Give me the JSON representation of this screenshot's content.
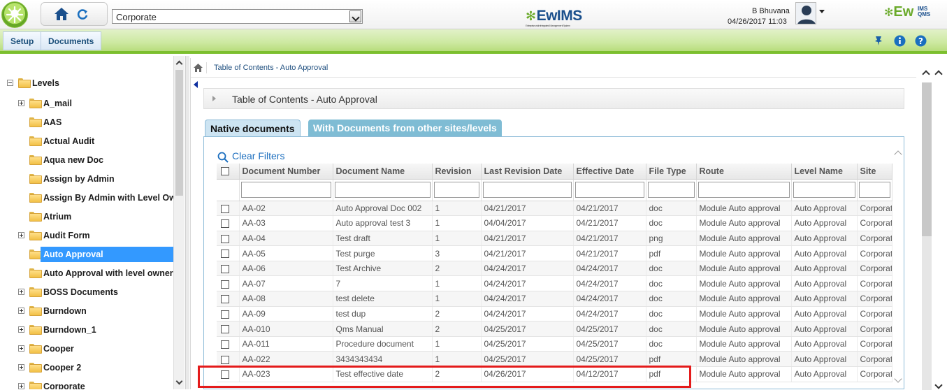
{
  "header": {
    "site_value": "Corporate",
    "brand_center": "EwIMS",
    "brand_center_sub": "Enterprise wide Integrated Management System",
    "user_name": "B Bhuvana",
    "datetime": "04/26/2017 11:03",
    "brand_right": "Ew",
    "brand_right_sup_1": "IMS",
    "brand_right_sup_2": "QMS"
  },
  "menu": {
    "setup": "Setup",
    "documents": "Documents"
  },
  "tree": {
    "root": "Levels",
    "items": [
      {
        "label": "A_mail",
        "expandable": true
      },
      {
        "label": "AAS",
        "expandable": false
      },
      {
        "label": "Actual Audit",
        "expandable": false
      },
      {
        "label": "Aqua new Doc",
        "expandable": false
      },
      {
        "label": "Assign by Admin",
        "expandable": false
      },
      {
        "label": "Assign By Admin with Level Owr",
        "expandable": false
      },
      {
        "label": "Atrium",
        "expandable": false
      },
      {
        "label": "Audit Form",
        "expandable": true
      },
      {
        "label": "Auto Approval",
        "expandable": false,
        "selected": true
      },
      {
        "label": "Auto Approval with level owner",
        "expandable": false
      },
      {
        "label": "BOSS Documents",
        "expandable": true
      },
      {
        "label": "Burndown",
        "expandable": true
      },
      {
        "label": "Burndown_1",
        "expandable": true
      },
      {
        "label": "Cooper",
        "expandable": true
      },
      {
        "label": "Cooper 2",
        "expandable": true
      },
      {
        "label": "Corporate",
        "expandable": true
      }
    ]
  },
  "breadcrumb": "Table of Contents - Auto Approval",
  "panel_title": "Table of Contents - Auto Approval",
  "tabs": {
    "native": "Native documents",
    "other": "With Documents from other sites/levels"
  },
  "clear_filters": "Clear Filters",
  "columns": [
    "Document Number",
    "Document Name",
    "Revision",
    "Last Revision Date",
    "Effective Date",
    "File Type",
    "Route",
    "Level Name",
    "Site"
  ],
  "rows": [
    [
      "AA-02",
      "Auto Approval Doc 002",
      "1",
      "04/21/2017",
      "04/21/2017",
      "doc",
      "Module Auto approval",
      "Auto Approval",
      "Corporat"
    ],
    [
      "AA-03",
      "Auto approval test 3",
      "1",
      "04/04/2017",
      "04/21/2017",
      "doc",
      "Module Auto approval",
      "Auto Approval",
      "Corporat"
    ],
    [
      "AA-04",
      "Test draft",
      "1",
      "04/21/2017",
      "04/21/2017",
      "png",
      "Module Auto approval",
      "Auto Approval",
      "Corporat"
    ],
    [
      "AA-05",
      "Test purge",
      "3",
      "04/21/2017",
      "04/21/2017",
      "pdf",
      "Module Auto approval",
      "Auto Approval",
      "Corporat"
    ],
    [
      "AA-06",
      "Test Archive",
      "2",
      "04/24/2017",
      "04/24/2017",
      "doc",
      "Module Auto approval",
      "Auto Approval",
      "Corporat"
    ],
    [
      "AA-07",
      "7",
      "1",
      "04/24/2017",
      "04/24/2017",
      "doc",
      "Module Auto approval",
      "Auto Approval",
      "Corporat"
    ],
    [
      "AA-08",
      "test delete",
      "1",
      "04/24/2017",
      "04/24/2017",
      "doc",
      "Module Auto approval",
      "Auto Approval",
      "Corporat"
    ],
    [
      "AA-09",
      "test dup",
      "2",
      "04/24/2017",
      "04/24/2017",
      "doc",
      "Module Auto approval",
      "Auto Approval",
      "Corporat"
    ],
    [
      "AA-010",
      "Qms Manual",
      "2",
      "04/25/2017",
      "04/25/2017",
      "doc",
      "Module Auto approval",
      "Auto Approval",
      "Corporat"
    ],
    [
      "AA-011",
      "Procedure document",
      "1",
      "04/25/2017",
      "04/25/2017",
      "doc",
      "Module Auto approval",
      "Auto Approval",
      "Corporat"
    ],
    [
      "AA-022",
      "3434343434",
      "1",
      "04/25/2017",
      "04/25/2017",
      "pdf",
      "Module Auto approval",
      "Auto Approval",
      "Corporat"
    ],
    [
      "AA-023",
      "Test effective date",
      "2",
      "04/26/2017",
      "04/12/2017",
      "pdf",
      "Module Auto approval",
      "Auto Approval",
      "Corporat"
    ]
  ],
  "colors": {
    "accent": "#7cbf2e",
    "link": "#1d7ac7",
    "selected": "#3399ff",
    "highlight": "#e41b1b"
  }
}
